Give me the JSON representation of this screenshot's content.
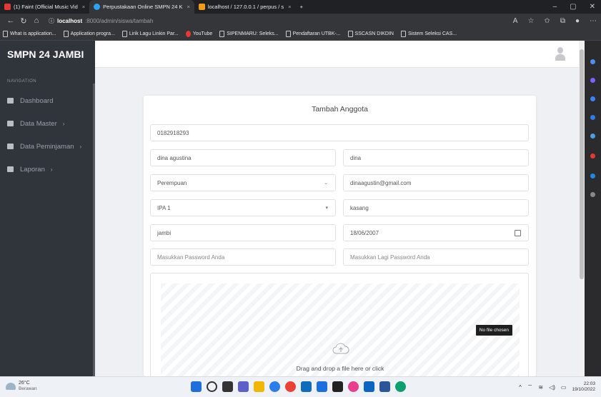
{
  "browser": {
    "tabs": [
      {
        "label": "(1) Faint (Official Music Vid",
        "active": false,
        "icon_color": "#e53935"
      },
      {
        "label": "Perpustakaan Online SMPN 24 K",
        "active": true,
        "icon_color": "#2ea3f2"
      },
      {
        "label": "localhost / 127.0.0.1 / perpus / s",
        "active": false,
        "icon_color": "#f39c12"
      }
    ],
    "new_tab": "+",
    "url_host": "localhost",
    "url_path": ":8000/admin/siswa/tambah",
    "bookmarks": [
      "What is application...",
      "Application progra...",
      "Lirik Lagu Linkin Par...",
      "YouTube",
      "SIPENMARU: Seleks...",
      "Pendaftaran UTBK-...",
      "SSCASN DIKDIN",
      "Sistem Seleksi CAS..."
    ]
  },
  "sidebar": {
    "brand": "SMPN 24 JAMBI",
    "nav_label": "NAVIGATION",
    "items": [
      {
        "label": "Dashboard",
        "chevron": ""
      },
      {
        "label": "Data Master",
        "chevron": "›"
      },
      {
        "label": "Data Peminjaman",
        "chevron": "›"
      },
      {
        "label": "Laporan",
        "chevron": "›"
      }
    ]
  },
  "form": {
    "title": "Tambah Anggota",
    "nis": "0182918293",
    "nama": "dina agustina",
    "username": "dina",
    "gender": "Perempuan",
    "email": "dinaagustin@gmail.com",
    "kelas": "IPA 1",
    "tempat": "kasang",
    "alamat": "jambi",
    "tanggal_lahir": "18/06/2007",
    "password_placeholder": "Masukkan Password Anda",
    "password_confirm_placeholder": "Masukkan Lagi Password Anda",
    "file_status": "No file chosen",
    "dropzone_text": "Drag and drop a file here or click"
  },
  "taskbar": {
    "temperature": "26°C",
    "weather": "Berawan",
    "time": "22:03",
    "date": "19/10/2022"
  }
}
